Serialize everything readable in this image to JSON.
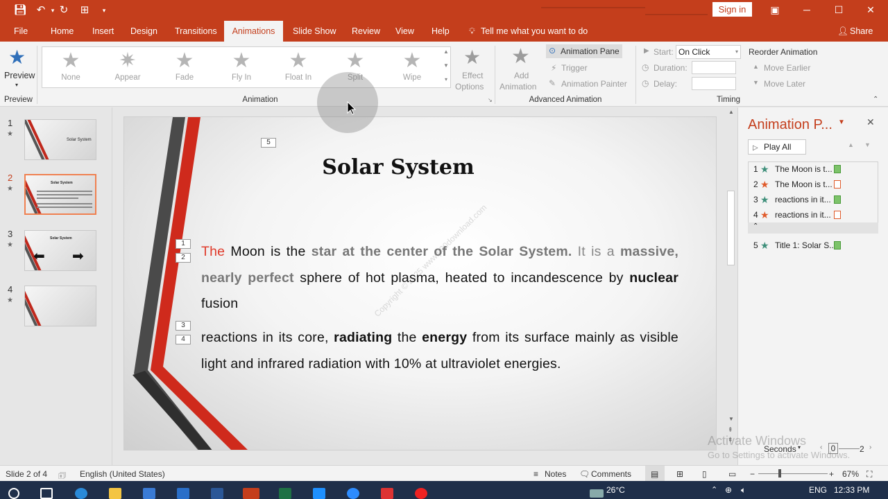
{
  "colors": {
    "accent": "#c43e1c",
    "green_star": "#3e8f7a",
    "orange_star": "#e05a2a"
  },
  "titlebar": {
    "signin_label": "Sign in"
  },
  "menu": {
    "tabs": [
      "File",
      "Home",
      "Insert",
      "Design",
      "Transitions",
      "Animations",
      "Slide Show",
      "Review",
      "View",
      "Help"
    ],
    "tell_me": "Tell me what you want to do",
    "share": "Share"
  },
  "ribbon": {
    "preview_label": "Preview",
    "preview_group": "Preview",
    "animation_group": "Animation",
    "gallery": [
      "None",
      "Appear",
      "Fade",
      "Fly In",
      "Float In",
      "Split",
      "Wipe"
    ],
    "effect_options": [
      "Effect",
      "Options"
    ],
    "add_animation": [
      "Add",
      "Animation"
    ],
    "animation_pane_label": "Animation Pane",
    "trigger_label": "Trigger",
    "animation_painter_label": "Animation Painter",
    "advanced_group": "Advanced Animation",
    "start_label": "Start:",
    "start_value": "On Click",
    "duration_label": "Duration:",
    "delay_label": "Delay:",
    "timing_group": "Timing",
    "reorder_label": "Reorder Animation",
    "move_earlier": "Move Earlier",
    "move_later": "Move Later"
  },
  "thumbnails": [
    {
      "num": "1",
      "text": "Solar System"
    },
    {
      "num": "2",
      "text": "Solar System"
    },
    {
      "num": "3",
      "text": "Solar System"
    },
    {
      "num": "4",
      "text": ""
    }
  ],
  "slide": {
    "title": "Solar System",
    "title_tag": "5",
    "tags": [
      "1",
      "2",
      "3",
      "4"
    ],
    "p1": {
      "the": "The",
      "moon": " Moon is the ",
      "star": "star at the center of the Solar System.",
      "itis": " It is a",
      "massive": "massive, nearly perfect",
      "sphere": " sphere of hot plasma, heated to incandescence by ",
      "nuclear": "nuclear",
      "fusion": " fusion"
    },
    "p2": {
      "a": "reactions in its core, ",
      "radiating": "radiating",
      "b": " the ",
      "energy": "energy",
      "c": " from its surface mainly as visible light and infrared radiation with 10% at ultraviolet energies."
    },
    "watermark": "Copyright © 2025 www.p30download.com"
  },
  "animation_pane": {
    "title": "Animation P...",
    "play_all": "Play All",
    "items": [
      {
        "num": "1",
        "text": "The Moon is t...",
        "star": "green",
        "box": "green"
      },
      {
        "num": "2",
        "text": "The Moon is t...",
        "star": "orange",
        "box": "orange"
      },
      {
        "num": "3",
        "text": "reactions in it...",
        "star": "green",
        "box": "green"
      },
      {
        "num": "4",
        "text": "reactions in it...",
        "star": "orange",
        "box": "orange"
      },
      {
        "num": "5",
        "text": "Title 1: Solar S...",
        "star": "green",
        "box": "green"
      }
    ],
    "seconds_label": "Seconds",
    "timeline_start": "0",
    "timeline_end": "2"
  },
  "activate": {
    "line1": "Activate Windows",
    "line2": "Go to Settings to activate Windows."
  },
  "status": {
    "slide_info": "Slide 2 of 4",
    "language": "English (United States)",
    "notes": "Notes",
    "comments": "Comments",
    "zoom": "67%"
  },
  "taskbar": {
    "time": "12:33 PM",
    "lang": "ENG",
    "temp": "26°C"
  }
}
